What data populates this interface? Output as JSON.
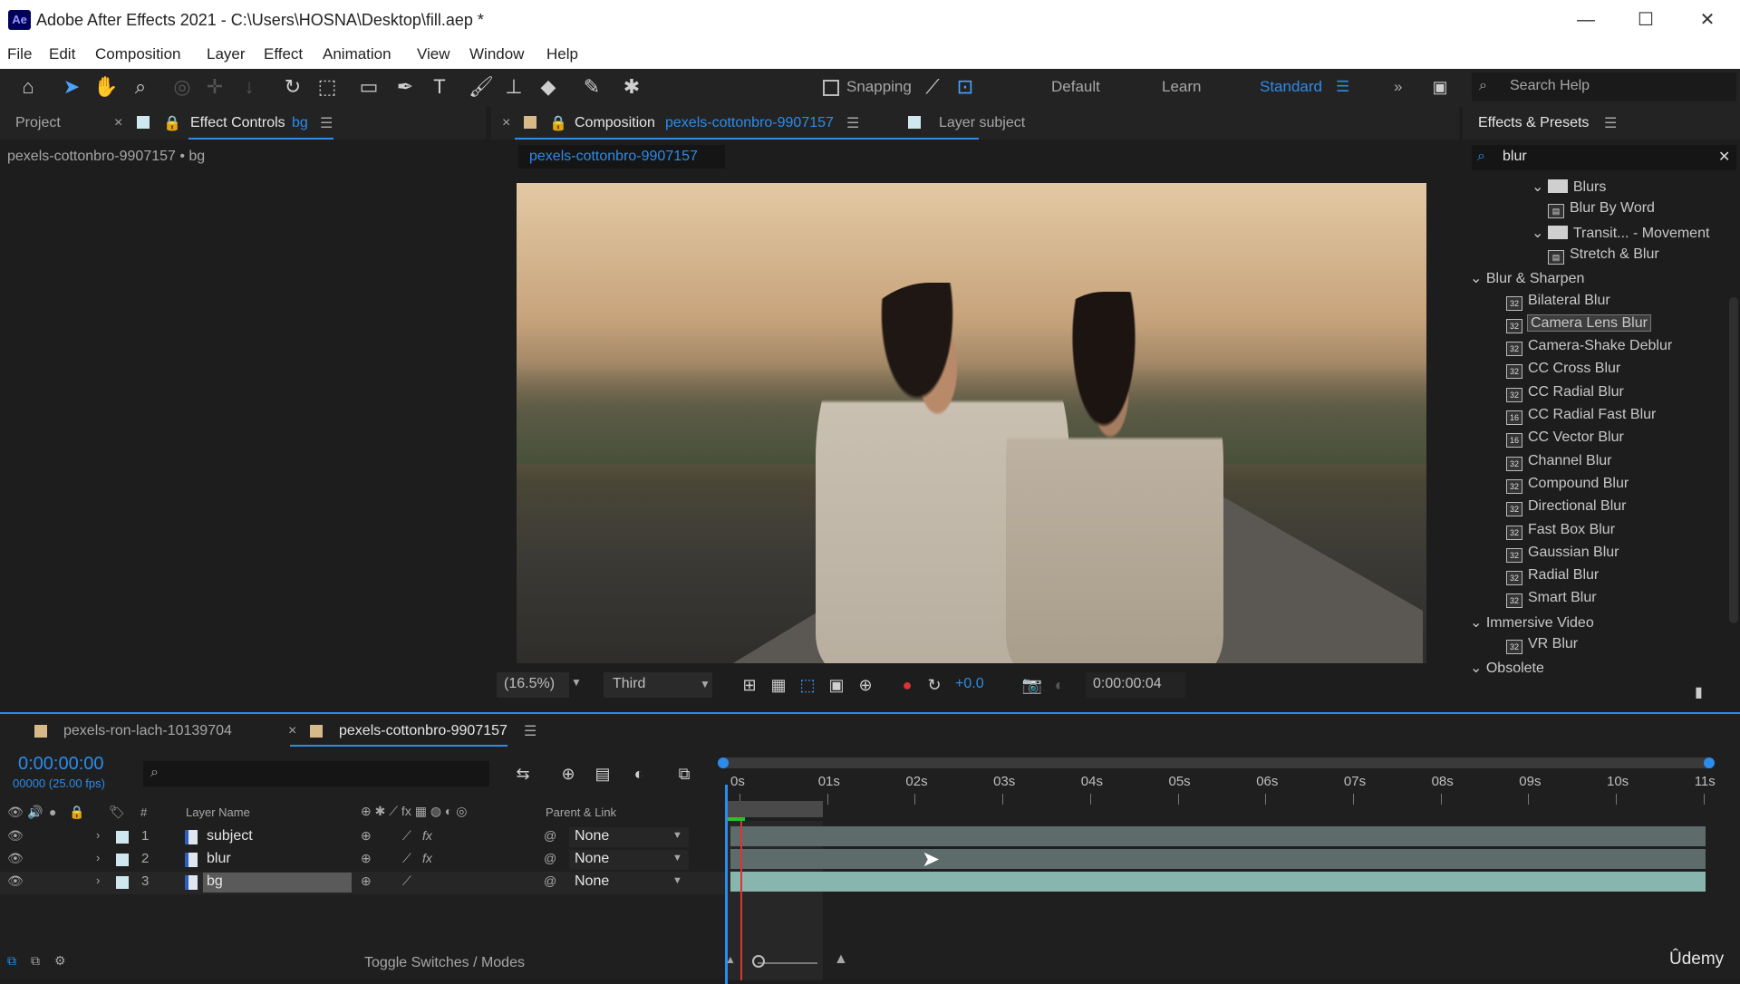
{
  "window": {
    "app_icon": "Ae",
    "title": "Adobe After Effects 2021 - C:\\Users\\HOSNA\\Desktop\\fill.aep *"
  },
  "menu": [
    "File",
    "Edit",
    "Composition",
    "Layer",
    "Effect",
    "Animation",
    "View",
    "Window",
    "Help"
  ],
  "toolbar": {
    "snapping": "Snapping",
    "workspaces": [
      "Default",
      "Learn",
      "Standard"
    ],
    "search_help": "Search Help"
  },
  "left_panel": {
    "tab_project": "Project",
    "tab_effect_controls": "Effect Controls",
    "effect_controls_layer": "bg",
    "subtitle": "pexels-cottonbro-9907157 • bg"
  },
  "comp_panel": {
    "tab_composition": "Composition",
    "comp_name": "pexels-cottonbro-9907157",
    "tab_layer": "Layer subject",
    "breadcrumb": "pexels-cottonbro-9907157",
    "zoom": "(16.5%)",
    "resolution": "Third",
    "exposure": "+0.0",
    "timecode": "0:00:00:04"
  },
  "effects_panel": {
    "title": "Effects & Presets",
    "search": "blur",
    "items": [
      {
        "label": "Blurs",
        "type": "folder",
        "indent": 2
      },
      {
        "label": "Blur By Word",
        "type": "preset",
        "indent": 3
      },
      {
        "label": "Transit... - Movement",
        "type": "folder",
        "indent": 2
      },
      {
        "label": "Stretch & Blur",
        "type": "preset",
        "indent": 3
      },
      {
        "label": "Blur & Sharpen",
        "type": "category",
        "indent": 0
      },
      {
        "label": "Bilateral Blur",
        "type": "effect",
        "indent": 1,
        "badge": "32"
      },
      {
        "label": "Camera Lens Blur",
        "type": "effect",
        "indent": 1,
        "badge": "32",
        "selected": true
      },
      {
        "label": "Camera-Shake Deblur",
        "type": "effect",
        "indent": 1,
        "badge": "32"
      },
      {
        "label": "CC Cross Blur",
        "type": "effect",
        "indent": 1,
        "badge": "32"
      },
      {
        "label": "CC Radial Blur",
        "type": "effect",
        "indent": 1,
        "badge": "32"
      },
      {
        "label": "CC Radial Fast Blur",
        "type": "effect",
        "indent": 1,
        "badge": "16"
      },
      {
        "label": "CC Vector Blur",
        "type": "effect",
        "indent": 1,
        "badge": "16"
      },
      {
        "label": "Channel Blur",
        "type": "effect",
        "indent": 1,
        "badge": "32"
      },
      {
        "label": "Compound Blur",
        "type": "effect",
        "indent": 1,
        "badge": "32"
      },
      {
        "label": "Directional Blur",
        "type": "effect",
        "indent": 1,
        "badge": "32"
      },
      {
        "label": "Fast Box Blur",
        "type": "effect",
        "indent": 1,
        "badge": "32"
      },
      {
        "label": "Gaussian Blur",
        "type": "effect",
        "indent": 1,
        "badge": "32"
      },
      {
        "label": "Radial Blur",
        "type": "effect",
        "indent": 1,
        "badge": "32"
      },
      {
        "label": "Smart Blur",
        "type": "effect",
        "indent": 1,
        "badge": "32"
      },
      {
        "label": "Immersive Video",
        "type": "category",
        "indent": 0
      },
      {
        "label": "VR Blur",
        "type": "effect",
        "indent": 1,
        "badge": "32"
      },
      {
        "label": "Obsolete",
        "type": "category",
        "indent": 0
      }
    ]
  },
  "timeline": {
    "tab1": "pexels-ron-lach-10139704",
    "tab2": "pexels-cottonbro-9907157",
    "timecode": "0:00:00:00",
    "frames": "00000 (25.00 fps)",
    "col_layer_name": "Layer Name",
    "col_hash": "#",
    "col_parent": "Parent & Link",
    "toggle": "Toggle Switches / Modes",
    "ruler": [
      "0s",
      "01s",
      "02s",
      "03s",
      "04s",
      "05s",
      "06s",
      "07s",
      "08s",
      "09s",
      "10s",
      "11s"
    ],
    "layers": [
      {
        "num": "1",
        "name": "subject",
        "parent": "None"
      },
      {
        "num": "2",
        "name": "blur",
        "parent": "None"
      },
      {
        "num": "3",
        "name": "bg",
        "parent": "None"
      }
    ]
  },
  "watermark": "Ûdemy"
}
